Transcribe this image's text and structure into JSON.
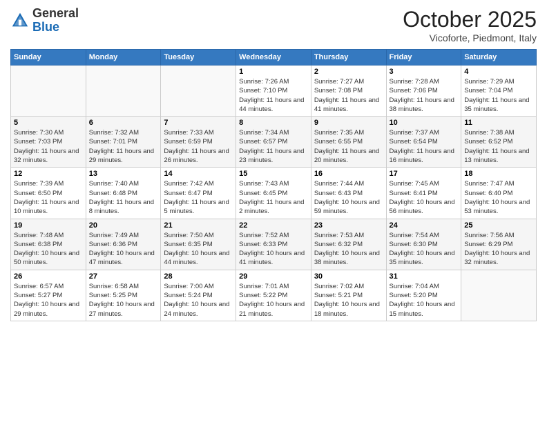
{
  "header": {
    "logo_general": "General",
    "logo_blue": "Blue",
    "month": "October 2025",
    "location": "Vicoforte, Piedmont, Italy"
  },
  "days_of_week": [
    "Sunday",
    "Monday",
    "Tuesday",
    "Wednesday",
    "Thursday",
    "Friday",
    "Saturday"
  ],
  "weeks": [
    [
      {
        "day": "",
        "sunrise": "",
        "sunset": "",
        "daylight": ""
      },
      {
        "day": "",
        "sunrise": "",
        "sunset": "",
        "daylight": ""
      },
      {
        "day": "",
        "sunrise": "",
        "sunset": "",
        "daylight": ""
      },
      {
        "day": "1",
        "sunrise": "Sunrise: 7:26 AM",
        "sunset": "Sunset: 7:10 PM",
        "daylight": "Daylight: 11 hours and 44 minutes."
      },
      {
        "day": "2",
        "sunrise": "Sunrise: 7:27 AM",
        "sunset": "Sunset: 7:08 PM",
        "daylight": "Daylight: 11 hours and 41 minutes."
      },
      {
        "day": "3",
        "sunrise": "Sunrise: 7:28 AM",
        "sunset": "Sunset: 7:06 PM",
        "daylight": "Daylight: 11 hours and 38 minutes."
      },
      {
        "day": "4",
        "sunrise": "Sunrise: 7:29 AM",
        "sunset": "Sunset: 7:04 PM",
        "daylight": "Daylight: 11 hours and 35 minutes."
      }
    ],
    [
      {
        "day": "5",
        "sunrise": "Sunrise: 7:30 AM",
        "sunset": "Sunset: 7:03 PM",
        "daylight": "Daylight: 11 hours and 32 minutes."
      },
      {
        "day": "6",
        "sunrise": "Sunrise: 7:32 AM",
        "sunset": "Sunset: 7:01 PM",
        "daylight": "Daylight: 11 hours and 29 minutes."
      },
      {
        "day": "7",
        "sunrise": "Sunrise: 7:33 AM",
        "sunset": "Sunset: 6:59 PM",
        "daylight": "Daylight: 11 hours and 26 minutes."
      },
      {
        "day": "8",
        "sunrise": "Sunrise: 7:34 AM",
        "sunset": "Sunset: 6:57 PM",
        "daylight": "Daylight: 11 hours and 23 minutes."
      },
      {
        "day": "9",
        "sunrise": "Sunrise: 7:35 AM",
        "sunset": "Sunset: 6:55 PM",
        "daylight": "Daylight: 11 hours and 20 minutes."
      },
      {
        "day": "10",
        "sunrise": "Sunrise: 7:37 AM",
        "sunset": "Sunset: 6:54 PM",
        "daylight": "Daylight: 11 hours and 16 minutes."
      },
      {
        "day": "11",
        "sunrise": "Sunrise: 7:38 AM",
        "sunset": "Sunset: 6:52 PM",
        "daylight": "Daylight: 11 hours and 13 minutes."
      }
    ],
    [
      {
        "day": "12",
        "sunrise": "Sunrise: 7:39 AM",
        "sunset": "Sunset: 6:50 PM",
        "daylight": "Daylight: 11 hours and 10 minutes."
      },
      {
        "day": "13",
        "sunrise": "Sunrise: 7:40 AM",
        "sunset": "Sunset: 6:48 PM",
        "daylight": "Daylight: 11 hours and 8 minutes."
      },
      {
        "day": "14",
        "sunrise": "Sunrise: 7:42 AM",
        "sunset": "Sunset: 6:47 PM",
        "daylight": "Daylight: 11 hours and 5 minutes."
      },
      {
        "day": "15",
        "sunrise": "Sunrise: 7:43 AM",
        "sunset": "Sunset: 6:45 PM",
        "daylight": "Daylight: 11 hours and 2 minutes."
      },
      {
        "day": "16",
        "sunrise": "Sunrise: 7:44 AM",
        "sunset": "Sunset: 6:43 PM",
        "daylight": "Daylight: 10 hours and 59 minutes."
      },
      {
        "day": "17",
        "sunrise": "Sunrise: 7:45 AM",
        "sunset": "Sunset: 6:41 PM",
        "daylight": "Daylight: 10 hours and 56 minutes."
      },
      {
        "day": "18",
        "sunrise": "Sunrise: 7:47 AM",
        "sunset": "Sunset: 6:40 PM",
        "daylight": "Daylight: 10 hours and 53 minutes."
      }
    ],
    [
      {
        "day": "19",
        "sunrise": "Sunrise: 7:48 AM",
        "sunset": "Sunset: 6:38 PM",
        "daylight": "Daylight: 10 hours and 50 minutes."
      },
      {
        "day": "20",
        "sunrise": "Sunrise: 7:49 AM",
        "sunset": "Sunset: 6:36 PM",
        "daylight": "Daylight: 10 hours and 47 minutes."
      },
      {
        "day": "21",
        "sunrise": "Sunrise: 7:50 AM",
        "sunset": "Sunset: 6:35 PM",
        "daylight": "Daylight: 10 hours and 44 minutes."
      },
      {
        "day": "22",
        "sunrise": "Sunrise: 7:52 AM",
        "sunset": "Sunset: 6:33 PM",
        "daylight": "Daylight: 10 hours and 41 minutes."
      },
      {
        "day": "23",
        "sunrise": "Sunrise: 7:53 AM",
        "sunset": "Sunset: 6:32 PM",
        "daylight": "Daylight: 10 hours and 38 minutes."
      },
      {
        "day": "24",
        "sunrise": "Sunrise: 7:54 AM",
        "sunset": "Sunset: 6:30 PM",
        "daylight": "Daylight: 10 hours and 35 minutes."
      },
      {
        "day": "25",
        "sunrise": "Sunrise: 7:56 AM",
        "sunset": "Sunset: 6:29 PM",
        "daylight": "Daylight: 10 hours and 32 minutes."
      }
    ],
    [
      {
        "day": "26",
        "sunrise": "Sunrise: 6:57 AM",
        "sunset": "Sunset: 5:27 PM",
        "daylight": "Daylight: 10 hours and 29 minutes."
      },
      {
        "day": "27",
        "sunrise": "Sunrise: 6:58 AM",
        "sunset": "Sunset: 5:25 PM",
        "daylight": "Daylight: 10 hours and 27 minutes."
      },
      {
        "day": "28",
        "sunrise": "Sunrise: 7:00 AM",
        "sunset": "Sunset: 5:24 PM",
        "daylight": "Daylight: 10 hours and 24 minutes."
      },
      {
        "day": "29",
        "sunrise": "Sunrise: 7:01 AM",
        "sunset": "Sunset: 5:22 PM",
        "daylight": "Daylight: 10 hours and 21 minutes."
      },
      {
        "day": "30",
        "sunrise": "Sunrise: 7:02 AM",
        "sunset": "Sunset: 5:21 PM",
        "daylight": "Daylight: 10 hours and 18 minutes."
      },
      {
        "day": "31",
        "sunrise": "Sunrise: 7:04 AM",
        "sunset": "Sunset: 5:20 PM",
        "daylight": "Daylight: 10 hours and 15 minutes."
      },
      {
        "day": "",
        "sunrise": "",
        "sunset": "",
        "daylight": ""
      }
    ]
  ]
}
